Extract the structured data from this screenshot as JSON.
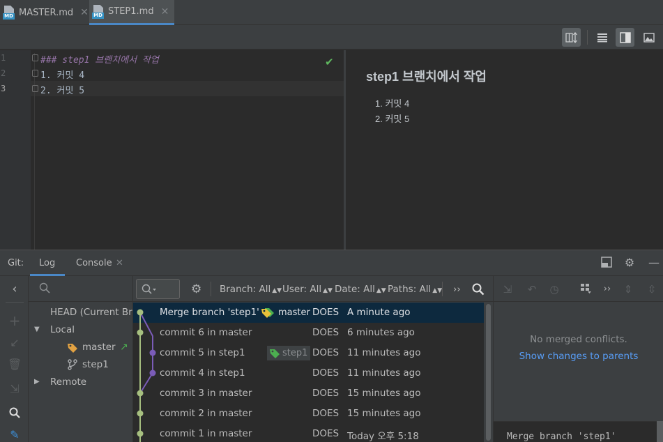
{
  "tabs": [
    {
      "label": "MASTER.md",
      "icon": "markdown-file-icon",
      "active": false
    },
    {
      "label": "STEP1.md",
      "icon": "markdown-file-icon",
      "active": true
    }
  ],
  "editor": {
    "line_numbers": [
      "1",
      "2",
      "3"
    ],
    "lines": [
      "### step1 브랜치에서 작업",
      "1. 커밋 4",
      "2. 커밋 5"
    ],
    "current_line": 3,
    "status": "check-icon"
  },
  "preview": {
    "title": "step1 브랜치에서 작업",
    "items": [
      "1. 커밋 4",
      "2. 커밋 5"
    ]
  },
  "git": {
    "label": "Git:",
    "tabs": [
      {
        "label": "Log",
        "active": true
      },
      {
        "label": "Console",
        "active": false
      }
    ],
    "branches": {
      "head": "HEAD (Current Branch)",
      "local_label": "Local",
      "local": [
        "master",
        "step1"
      ],
      "remote_label": "Remote"
    },
    "filters": {
      "branch": "Branch: All",
      "user": "User: All",
      "date": "Date: All",
      "paths": "Paths: All"
    },
    "commits": [
      {
        "message": "Merge branch 'step1'",
        "tag": "master",
        "author": "DOES",
        "date": "A minute ago",
        "selected": true
      },
      {
        "message": "commit 6 in master",
        "tag": "",
        "author": "DOES",
        "date": "6 minutes ago"
      },
      {
        "message": "commit 5 in step1",
        "tag": "step1",
        "author": "DOES",
        "date": "11 minutes ago"
      },
      {
        "message": "commit 4 in step1",
        "tag": "",
        "author": "DOES",
        "date": "11 minutes ago"
      },
      {
        "message": "commit 3 in master",
        "tag": "",
        "author": "DOES",
        "date": "15 minutes ago"
      },
      {
        "message": "commit 2 in master",
        "tag": "",
        "author": "DOES",
        "date": "15 minutes ago"
      },
      {
        "message": "commit 1 in master",
        "tag": "",
        "author": "DOES",
        "date": "Today 오후 5:18"
      }
    ],
    "details": {
      "no_conflicts": "No merged conflicts.",
      "show_changes": "Show changes to parents",
      "commit_message": "Merge branch 'step1'"
    }
  },
  "colors": {
    "accent": "#4a88c7",
    "selection": "#0d293e",
    "graph_master": "#a7c080",
    "graph_step1": "#7b5cb8",
    "link": "#589df6",
    "check": "#5fb85f"
  }
}
